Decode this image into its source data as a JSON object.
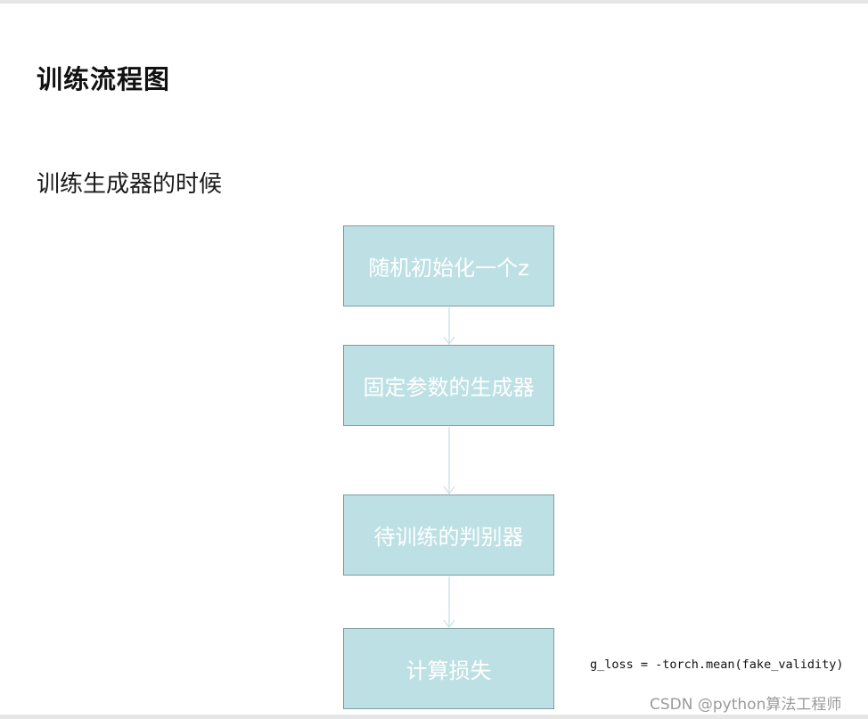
{
  "heading": "训练流程图",
  "subheading": "训练生成器的时候",
  "flow": {
    "steps": [
      "随机初始化一个z",
      "固定参数的生成器",
      "待训练的判别器",
      "计算损失"
    ]
  },
  "code_note": "g_loss = -torch.mean(fake_validity)",
  "watermark": "CSDN @python算法工程师",
  "colors": {
    "box_fill": "#bde0e4",
    "box_border": "#7f9c9f",
    "arrow": "#c9e3e6",
    "text_on_box": "#ffffff"
  }
}
